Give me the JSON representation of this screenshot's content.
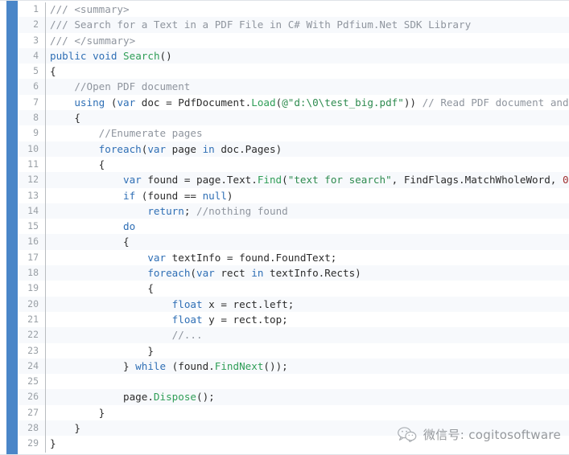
{
  "editor": {
    "language": "csharp",
    "first_line_number": 1,
    "total_lines": 29,
    "gutter_visible": true,
    "colors": {
      "background": "#ffffff",
      "stripe": "#f7f9fc",
      "accent_bar": "#4a86c8",
      "gutter_text": "#9aa0a6",
      "gutter_rule": "#b9bcc0",
      "keyword": "#2f6fb5",
      "comment": "#8f959e",
      "string": "#2e8b4f",
      "method": "#2e9e57",
      "number": "#a03030",
      "plain": "#2b2b2b"
    }
  },
  "lines": [
    {
      "n": "1",
      "tokens": [
        {
          "t": "/// ",
          "c": "cmt"
        },
        {
          "t": "<summary>",
          "c": "cmt"
        }
      ]
    },
    {
      "n": "2",
      "tokens": [
        {
          "t": "/// Search for a Text in a PDF File in C# With Pdfium.Net SDK Library",
          "c": "cmt"
        }
      ]
    },
    {
      "n": "3",
      "tokens": [
        {
          "t": "/// </summary>",
          "c": "cmt"
        }
      ]
    },
    {
      "n": "4",
      "tokens": [
        {
          "t": "public",
          "c": "kw"
        },
        {
          "t": " ",
          "c": "pln"
        },
        {
          "t": "void",
          "c": "kw"
        },
        {
          "t": " ",
          "c": "pln"
        },
        {
          "t": "Search",
          "c": "mth"
        },
        {
          "t": "()",
          "c": "pln"
        }
      ]
    },
    {
      "n": "5",
      "tokens": [
        {
          "t": "{",
          "c": "pln"
        }
      ]
    },
    {
      "n": "6",
      "tokens": [
        {
          "t": "    //Open PDF document",
          "c": "cmt"
        }
      ]
    },
    {
      "n": "7",
      "tokens": [
        {
          "t": "    ",
          "c": "pln"
        },
        {
          "t": "using",
          "c": "kw"
        },
        {
          "t": " (",
          "c": "pln"
        },
        {
          "t": "var",
          "c": "kw"
        },
        {
          "t": " doc = PdfDocument.",
          "c": "pln"
        },
        {
          "t": "Load",
          "c": "mth"
        },
        {
          "t": "(",
          "c": "pln"
        },
        {
          "t": "@\"d:\\0\\test_big.pdf\"",
          "c": "str"
        },
        {
          "t": ")) ",
          "c": "pln"
        },
        {
          "t": "// Read PDF document and enume",
          "c": "cmt"
        }
      ]
    },
    {
      "n": "8",
      "tokens": [
        {
          "t": "    {",
          "c": "pln"
        }
      ]
    },
    {
      "n": "9",
      "tokens": [
        {
          "t": "        //Enumerate pages",
          "c": "cmt"
        }
      ]
    },
    {
      "n": "10",
      "tokens": [
        {
          "t": "        ",
          "c": "pln"
        },
        {
          "t": "foreach",
          "c": "kw"
        },
        {
          "t": "(",
          "c": "pln"
        },
        {
          "t": "var",
          "c": "kw"
        },
        {
          "t": " page ",
          "c": "pln"
        },
        {
          "t": "in",
          "c": "kw"
        },
        {
          "t": " doc.Pages)",
          "c": "pln"
        }
      ]
    },
    {
      "n": "11",
      "tokens": [
        {
          "t": "        {",
          "c": "pln"
        }
      ]
    },
    {
      "n": "12",
      "tokens": [
        {
          "t": "            ",
          "c": "pln"
        },
        {
          "t": "var",
          "c": "kw"
        },
        {
          "t": " found = page.Text.",
          "c": "pln"
        },
        {
          "t": "Find",
          "c": "mth"
        },
        {
          "t": "(",
          "c": "pln"
        },
        {
          "t": "\"text for search\"",
          "c": "str"
        },
        {
          "t": ", FindFlags.MatchWholeWord, ",
          "c": "pln"
        },
        {
          "t": "0",
          "c": "num"
        },
        {
          "t": ");",
          "c": "pln"
        }
      ]
    },
    {
      "n": "13",
      "tokens": [
        {
          "t": "            ",
          "c": "pln"
        },
        {
          "t": "if",
          "c": "kw"
        },
        {
          "t": " (found == ",
          "c": "pln"
        },
        {
          "t": "null",
          "c": "kw"
        },
        {
          "t": ")",
          "c": "pln"
        }
      ]
    },
    {
      "n": "14",
      "tokens": [
        {
          "t": "                ",
          "c": "pln"
        },
        {
          "t": "return",
          "c": "kw"
        },
        {
          "t": "; ",
          "c": "pln"
        },
        {
          "t": "//nothing found",
          "c": "cmt"
        }
      ]
    },
    {
      "n": "15",
      "tokens": [
        {
          "t": "            ",
          "c": "pln"
        },
        {
          "t": "do",
          "c": "kw"
        }
      ]
    },
    {
      "n": "16",
      "tokens": [
        {
          "t": "            {",
          "c": "pln"
        }
      ]
    },
    {
      "n": "17",
      "tokens": [
        {
          "t": "                ",
          "c": "pln"
        },
        {
          "t": "var",
          "c": "kw"
        },
        {
          "t": " textInfo = found.FoundText;",
          "c": "pln"
        }
      ]
    },
    {
      "n": "18",
      "tokens": [
        {
          "t": "                ",
          "c": "pln"
        },
        {
          "t": "foreach",
          "c": "kw"
        },
        {
          "t": "(",
          "c": "pln"
        },
        {
          "t": "var",
          "c": "kw"
        },
        {
          "t": " rect ",
          "c": "pln"
        },
        {
          "t": "in",
          "c": "kw"
        },
        {
          "t": " textInfo.Rects)",
          "c": "pln"
        }
      ]
    },
    {
      "n": "19",
      "tokens": [
        {
          "t": "                {",
          "c": "pln"
        }
      ]
    },
    {
      "n": "20",
      "tokens": [
        {
          "t": "                    ",
          "c": "pln"
        },
        {
          "t": "float",
          "c": "kw"
        },
        {
          "t": " x = rect.left;",
          "c": "pln"
        }
      ]
    },
    {
      "n": "21",
      "tokens": [
        {
          "t": "                    ",
          "c": "pln"
        },
        {
          "t": "float",
          "c": "kw"
        },
        {
          "t": " y = rect.top;",
          "c": "pln"
        }
      ]
    },
    {
      "n": "22",
      "tokens": [
        {
          "t": "                    //...",
          "c": "cmt"
        }
      ]
    },
    {
      "n": "23",
      "tokens": [
        {
          "t": "                }",
          "c": "pln"
        }
      ]
    },
    {
      "n": "24",
      "tokens": [
        {
          "t": "            } ",
          "c": "pln"
        },
        {
          "t": "while",
          "c": "kw"
        },
        {
          "t": " (found.",
          "c": "pln"
        },
        {
          "t": "FindNext",
          "c": "mth"
        },
        {
          "t": "());",
          "c": "pln"
        }
      ]
    },
    {
      "n": "25",
      "tokens": [
        {
          "t": "",
          "c": "pln"
        }
      ]
    },
    {
      "n": "26",
      "tokens": [
        {
          "t": "            page.",
          "c": "pln"
        },
        {
          "t": "Dispose",
          "c": "mth"
        },
        {
          "t": "();",
          "c": "pln"
        }
      ]
    },
    {
      "n": "27",
      "tokens": [
        {
          "t": "        }",
          "c": "pln"
        }
      ]
    },
    {
      "n": "28",
      "tokens": [
        {
          "t": "    }",
          "c": "pln"
        }
      ]
    },
    {
      "n": "29",
      "tokens": [
        {
          "t": "}",
          "c": "pln"
        }
      ]
    }
  ],
  "watermark": {
    "icon": "wechat-icon",
    "text": "微信号: cogitosoftware"
  }
}
